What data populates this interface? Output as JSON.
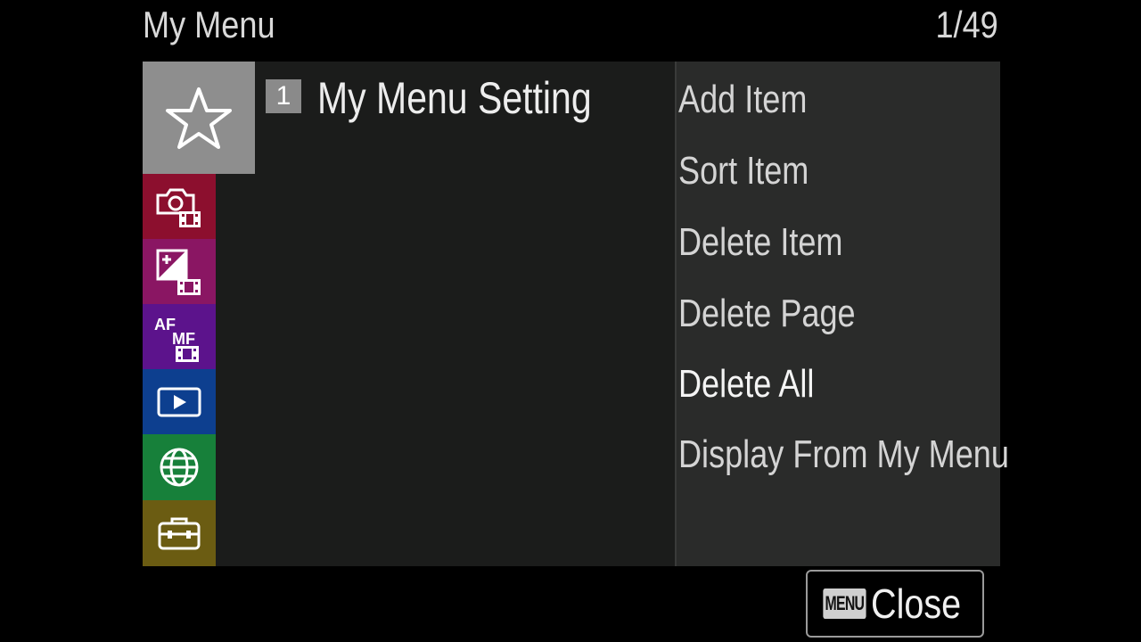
{
  "header": {
    "title": "My Menu",
    "page_counter": "1/49"
  },
  "tabs": [
    {
      "name": "my-menu",
      "icon": "star-icon",
      "color": "#8e8e8e",
      "selected": true
    },
    {
      "name": "shooting",
      "icon": "camera-movie-icon",
      "color": "#8c0f2e"
    },
    {
      "name": "exposure-color",
      "icon": "exposure-movie-icon",
      "color": "#8a1663"
    },
    {
      "name": "focus",
      "icon": "af-mf-movie-icon",
      "color": "#5c138c",
      "icon_text_top": "AF",
      "icon_text_bottom": "MF"
    },
    {
      "name": "playback",
      "icon": "play-icon",
      "color": "#0d3f8f"
    },
    {
      "name": "network",
      "icon": "globe-icon",
      "color": "#17803a"
    },
    {
      "name": "setup",
      "icon": "toolbox-icon",
      "color": "#6b5c12"
    }
  ],
  "page": {
    "number": "1",
    "title": "My Menu Setting"
  },
  "submenu": {
    "items": [
      {
        "label": "Add Item"
      },
      {
        "label": "Sort Item"
      },
      {
        "label": "Delete Item"
      },
      {
        "label": "Delete Page"
      },
      {
        "label": "Delete All"
      },
      {
        "label": "Display From My Menu"
      }
    ]
  },
  "footer": {
    "menu_key": "MENU",
    "close_label": "Close"
  }
}
